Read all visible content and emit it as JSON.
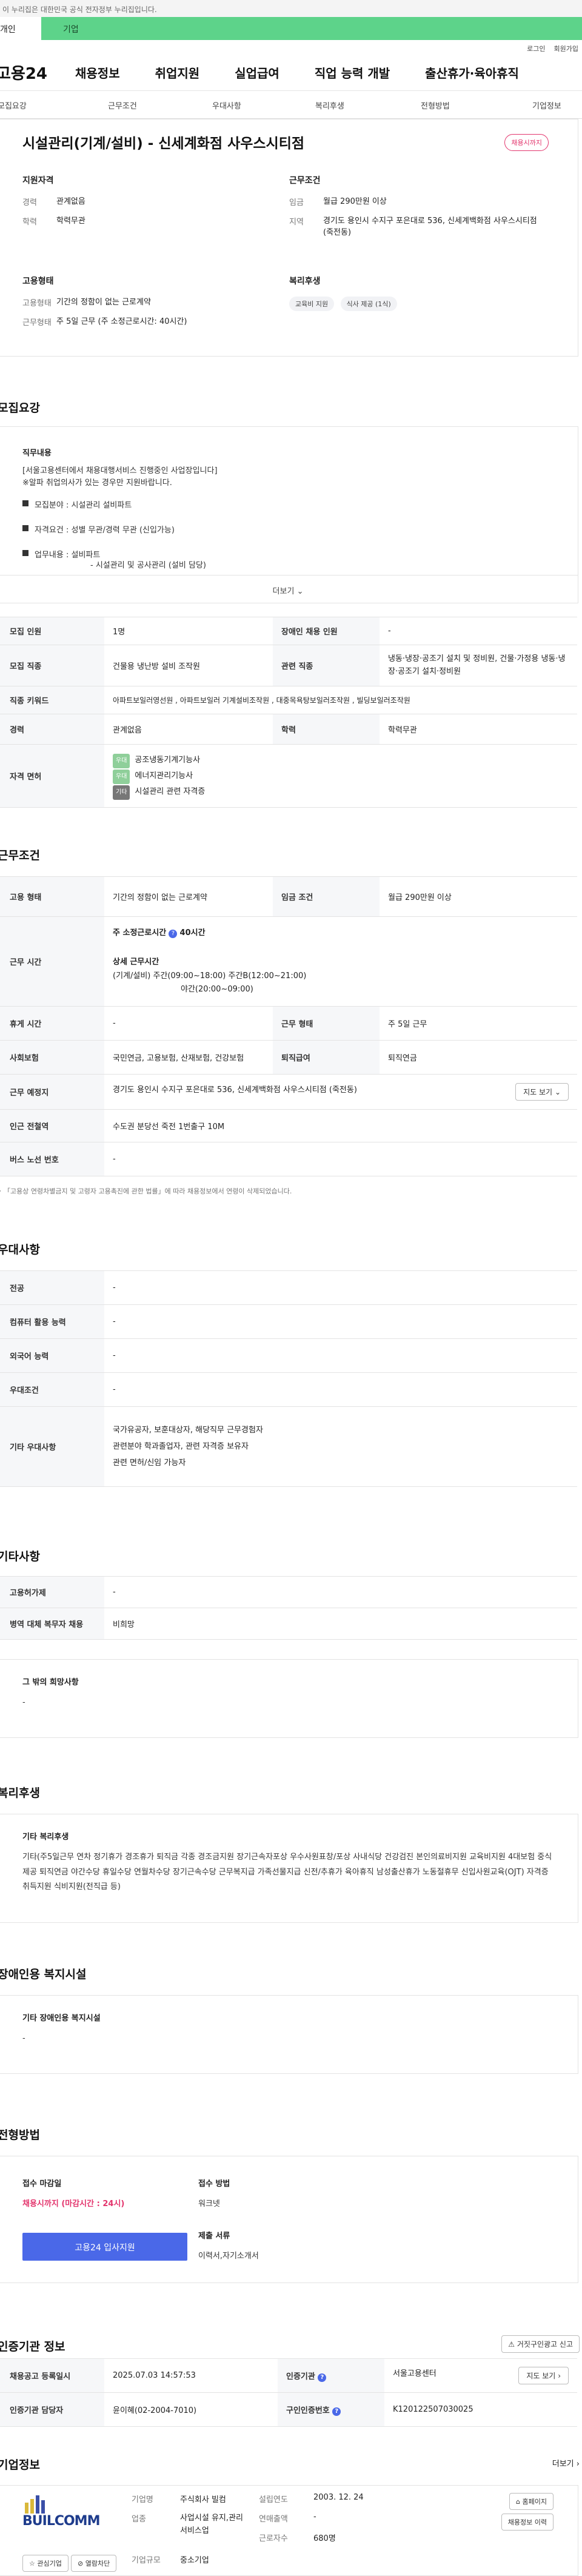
{
  "notice": "이 누리집은 대한민국 공식 전자정부 누리집입니다.",
  "usertype": {
    "a": "개인",
    "b": "기업"
  },
  "util": {
    "login": "로그인",
    "signup": "회원가입"
  },
  "gnb": {
    "logo": "고용24",
    "items": [
      "채용정보",
      "취업지원",
      "실업급여",
      "직업 능력 개발",
      "출산휴가·육아휴직"
    ]
  },
  "subtabs": [
    "모집요강",
    "근무조건",
    "우대사항",
    "복리후생",
    "전형방법",
    "기업정보"
  ],
  "job": {
    "title": "시설관리(기계/설비) - 신세계화점 사우스시티점",
    "badge": "채용시까지",
    "left_head": "지원자격",
    "career_k": "경력",
    "career_v": "관계없음",
    "edu_k": "학력",
    "edu_v": "학력무관",
    "emp_head": "고용형태",
    "emp_k": "고용형태",
    "emp_v": "기간의 정함이 없는 근로계약",
    "hours_k": "근무형태",
    "hours_v": "주 5일 근무 (주 소정근로시간: 40시간)",
    "right_head": "근무조건",
    "pay_k": "임금",
    "pay_v": "월급 290만원 이상",
    "loc_k": "지역",
    "loc_v": "경기도 용인시 수지구 포은대로 536, 신세계백화점 사우스시티점 (죽전동)",
    "welfare_head": "복리후생",
    "chips": [
      "교육비 지원",
      "식사 제공 (1식)"
    ]
  },
  "recruit": {
    "section": "모집요강",
    "head": "직무내용",
    "line1": "[서울고용센터에서 채용대행서비스 진행중인 사업장입니다]",
    "line2": "※알파 취업의사가 있는 경우만 지원바랍니다.",
    "b1": "모집분야 : 시설관리 설비파트",
    "b2": "자격요건 : 성별 무관/경력 무관 (신입가능)",
    "b3": "업무내용 :  설비파트",
    "b3b": "- 시설관리 및 공사관리 (설비 담당)",
    "more": "더보기"
  },
  "detail": {
    "rows": [
      {
        "k1": "모집 인원",
        "v1": "1명",
        "k2": "장애인 채용 인원",
        "v2": "-"
      },
      {
        "k1": "모집 직종",
        "v1": "건물용 냉난방 설비 조작원",
        "k2": "관련 직종",
        "v2": "냉동·냉장·공조기 설치 및 정비원, 건물·가정용 냉동·냉장·공조기 설치·정비원"
      },
      {
        "k1": "직종 키워드",
        "v1": "아파트보일러영선원 , 아파트보일러 기계설비조작원 , 대중목욕탕보일러조작원 , 빌딩보일러조작원"
      },
      {
        "k1": "경력",
        "v1": "관계없음",
        "k2": "학력",
        "v2": "학력무관"
      }
    ],
    "cert_k": "자격 면허",
    "certs": [
      {
        "tag": "우대",
        "name": "공조냉동기계기능사"
      },
      {
        "tag": "우대",
        "name": "에너지관리기능사"
      },
      {
        "tag": "기타",
        "name": "시설관리 관련 자격증"
      }
    ]
  },
  "cond": {
    "section": "근무조건",
    "emp_k": "고용 형태",
    "emp_v": "기간의 정함이 없는 근로계약",
    "pay_k": "임금 조건",
    "pay_v": "월급 290만원 이상",
    "time_k": "근무 시간",
    "time1": "주 소정근로시간",
    "time1b": "40시간",
    "time2": "상세 근무시간",
    "time3": "(기계/설비) 주간(09:00~18:00) 주간B(12:00~21:00)",
    "time4": "야간(20:00~09:00)",
    "rest_k": "휴게 시간",
    "rest_v": "-",
    "form_k": "근무 형태",
    "form_v": "주 5일 근무",
    "ins_k": "사회보험",
    "ins_v": "국민연금, 고용보험, 산재보험, 건강보험",
    "ret_k": "퇴직급여",
    "ret_v": "퇴직연금",
    "place_k": "근무 예정지",
    "place_v": "경기도 용인시 수지구 포은대로 536, 신세계백화점 사우스시티점 (죽전동)",
    "map": "지도 보기",
    "sub_k": "인근 전철역",
    "sub_v": "수도권 분당선 죽전 1번출구 10M",
    "bus_k": "버스 노선 번호",
    "bus_v": "-",
    "note": "「고용상 연령차별금지 및 고령자 고용촉진에 관한 법률」에 따라 채용정보에서 연령이 삭제되었습니다."
  },
  "pref": {
    "section": "우대사항",
    "rows": [
      {
        "k": "전공",
        "v": "-"
      },
      {
        "k": "컴퓨터 활용 능력",
        "v": "-"
      },
      {
        "k": "외국어 능력",
        "v": "-"
      },
      {
        "k": "우대조건",
        "v": "-"
      }
    ],
    "etc_k": "기타 우대사항",
    "etc1": "국가유공자, 보훈대상자, 해당직무 근무경험자",
    "etc2": "관련분야 학과졸업자, 관련 자격증 보유자",
    "etc3": "관련 면허/신임 가능자"
  },
  "other": {
    "section": "기타사항",
    "r1k": "고용허가제",
    "r1v": "-",
    "r2k": "병역 대체 복무자 채용",
    "r2v": "비희망",
    "wish_h": "그 밖의 희망사항",
    "wish_v": "-"
  },
  "welfare": {
    "section": "복리후생",
    "head": "기타 복리후생",
    "text": "기타(주5일근무 연차 정기휴가 경조휴가 퇴직금 각종 경조금지원 장기근속자포상 우수사원표창/포상 사내식당 건강검진 본인의료비지원 교육비지원 4대보험 중식제공 퇴직연금 야간수당 휴일수당 연월차수당 장기근속수당 근무복지급 가족선물지급 신전/추휴가 육아휴직 남성출산휴가 노동절휴무 신입사원교육(OJT) 자격증취득지원 식비지원(전직급 등)"
  },
  "disab": {
    "section": "장애인용 복지시설",
    "head": "기타 장애인용 복지시설",
    "v": "-"
  },
  "proc": {
    "section": "전형방법",
    "deadline_h": "접수 마감일",
    "deadline_v": "채용시까지 (마감시간 : 24시)",
    "apply": "고용24 입사지원",
    "method_h": "접수 방법",
    "method_v": "워크넷",
    "docs_h": "제출 서류",
    "docs_v": "이력서,자기소개서"
  },
  "cert": {
    "section": "인증기관 정보",
    "report": "거짓구인광고 신고",
    "reg_k": "채용공고 등록일시",
    "reg_v": "2025.07.03 14:57:53",
    "org_k": "인증기관",
    "org_v": "서울고용센터",
    "mgr_k": "인증기관 담당자",
    "mgr_v": "윤이혜(02-2004-7010)",
    "no_k": "구인인증번호",
    "no_v": "K120122507030025",
    "map": "지도 보기"
  },
  "company": {
    "section": "기업정보",
    "more": "더보기",
    "logo": "BUILCOMM",
    "fav": "관심기업",
    "block": "열람차단",
    "name_k": "기업명",
    "name_v": "주식회사 빌컴",
    "ind_k": "업종",
    "ind_v": "사업시설 유지,관리 서비스업",
    "size_k": "기업규모",
    "size_v": "중소기업",
    "est_k": "설립연도",
    "est_v": "2003. 12. 24",
    "sales_k": "연매출액",
    "sales_v": "-",
    "emp_k": "근로자수",
    "emp_v": "680명",
    "home": "홈페이지",
    "jobs": "채용정보 이력"
  }
}
